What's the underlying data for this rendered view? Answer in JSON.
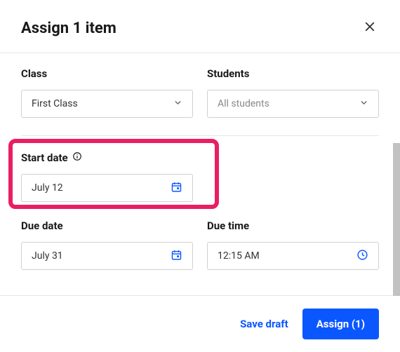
{
  "header": {
    "title": "Assign 1 item"
  },
  "fields": {
    "class": {
      "label": "Class",
      "value": "First Class"
    },
    "students": {
      "label": "Students",
      "placeholder": "All students"
    },
    "start_date": {
      "label": "Start date",
      "value": "July 12"
    },
    "due_date": {
      "label": "Due date",
      "value": "July 31"
    },
    "due_time": {
      "label": "Due time",
      "value": "12:15 AM"
    }
  },
  "footer": {
    "save_draft": "Save draft",
    "assign": "Assign (1)"
  }
}
